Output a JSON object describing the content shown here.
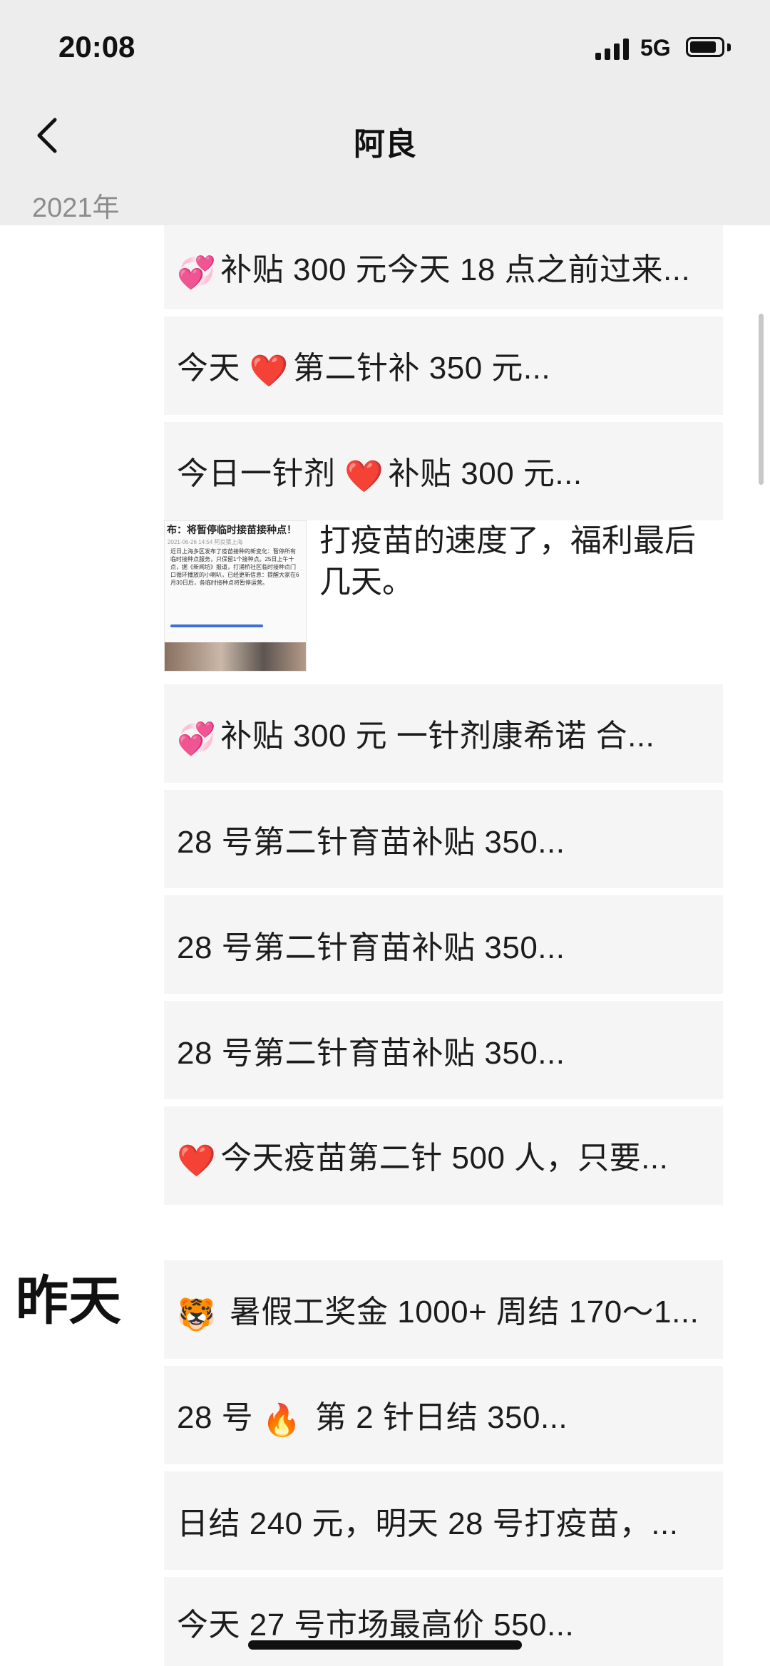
{
  "status": {
    "time": "20:08",
    "network": "5G",
    "battery_level": 0.85
  },
  "header": {
    "title": "阿良",
    "back_icon": "chevron-left-icon"
  },
  "year_label": "2021年",
  "items": [
    {
      "emoji": "💞",
      "text": "补贴 300 元今天 18 点之前过来..."
    },
    {
      "pre": "今天",
      "emoji": "❤️",
      "text": "第二针补 350 元..."
    },
    {
      "pre": "今日一针剂",
      "emoji": "❤️",
      "text": "补贴 300 元..."
    },
    {
      "caption": "打疫苗的速度了，福利最后几天。",
      "thumb": {
        "title": "布：将暂停临时接苗接种点！",
        "date": "2021-06-26 14:54  阿良猜上海",
        "body": "近日上海多区发布了疫苗接种的新变化：暂停所有临时接种点服务，只保留1个接种点。25日上午十点，据《新闻坊》报道，打浦桥社区临时接种点门口循环播放的小喇叭，已经更新信息：提醒大家在6月30日后，各临时接种点将暂停运营。"
      }
    },
    {
      "emoji": "💞",
      "text": "补贴 300 元  一针剂康希诺 合..."
    },
    {
      "text": "28 号第二针育苗补贴 350..."
    },
    {
      "text": "28 号第二针育苗补贴 350..."
    },
    {
      "text": "28 号第二针育苗补贴 350..."
    },
    {
      "emoji": "❤️",
      "text": "今天疫苗第二针 500 人，只要..."
    },
    {
      "emoji": "🐯",
      "text": " 暑假工奖金 1000+ 周结 170～1..."
    },
    {
      "pre": "28 号",
      "emoji": "🔥",
      "text": " 第 2 针日结 350..."
    },
    {
      "text": "日结 240 元，明天 28 号打疫苗，..."
    },
    {
      "text": "今天 27 号市场最高价 550..."
    }
  ],
  "day_label": "昨天"
}
